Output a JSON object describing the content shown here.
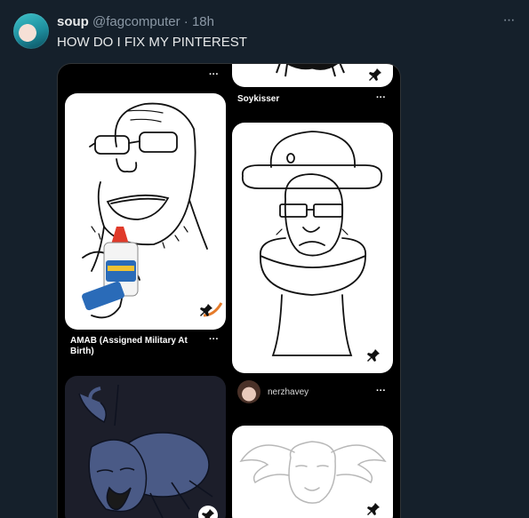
{
  "tweet": {
    "display_name": "soup",
    "handle": "@fagcomputer",
    "separator": "·",
    "time": "18h",
    "text": "HOW DO I FIX MY PINTEREST",
    "more_glyph": "···"
  },
  "pinterest": {
    "more_glyph": "···",
    "pins": [
      {
        "caption": ""
      },
      {
        "caption": "Soykisser"
      },
      {
        "caption": "AMAB (Assigned Military At Birth)"
      },
      {
        "caption": ""
      },
      {
        "caption": ""
      },
      {
        "caption": ""
      }
    ],
    "toilet_pin_user": "nerzhavey",
    "glue_brand": "Elmer's School Glue"
  },
  "colors": {
    "background": "#15202b",
    "media_background": "#000000",
    "accent_teal": "#1e8e9e"
  },
  "icons": {
    "tweet_more": "more-horizontal-icon",
    "pin": "pushpin-icon"
  }
}
